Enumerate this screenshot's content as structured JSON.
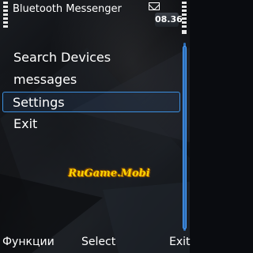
{
  "app": {
    "title": "Bluetooth Messenger"
  },
  "status": {
    "time": "08.36"
  },
  "menu": {
    "items": [
      {
        "label": "Search Devices"
      },
      {
        "label": "messages"
      },
      {
        "label": "Settings",
        "selected": true
      },
      {
        "label": "Exit"
      }
    ]
  },
  "watermark": {
    "text": "RuGame.Mobi"
  },
  "softkeys": {
    "left": "Функции",
    "center": "Select",
    "right": "Exit"
  },
  "colors": {
    "accent": "#3b8fe0",
    "logo": "#ffd400"
  }
}
